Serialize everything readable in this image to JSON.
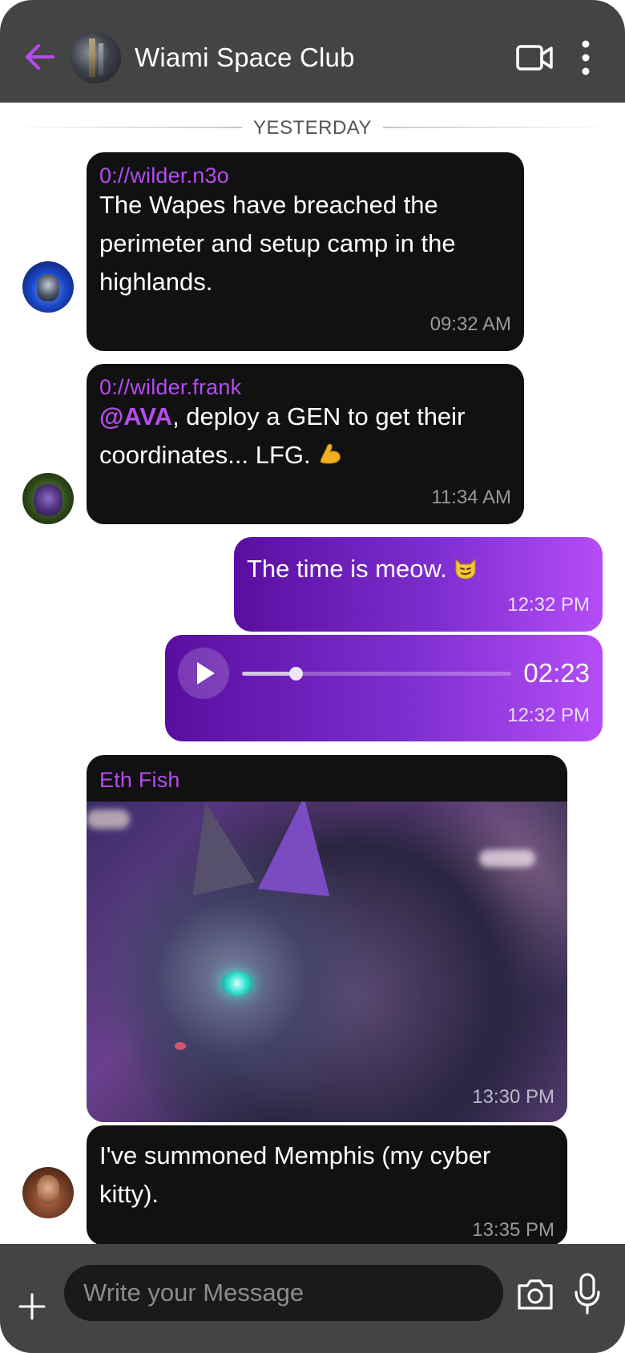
{
  "header": {
    "title": "Wiami Space Club",
    "back_icon": "arrow-left-icon",
    "video_icon": "video-call-icon",
    "more_icon": "more-vertical-icon"
  },
  "divider": {
    "label": "YESTERDAY"
  },
  "messages": [
    {
      "sender": "0://wilder.n3o",
      "lines": [
        "The Wapes have breached the",
        "perimeter and setup camp in the",
        "highlands."
      ],
      "time": "09:32 AM"
    },
    {
      "sender": "0://wilder.frank",
      "mention": "@AVA",
      "line1_rest": ", deploy a GEN to get their",
      "line2": "coordinates... LFG.",
      "emoji": "💪",
      "time": "11:34 AM"
    },
    {
      "text": "The time is meow.",
      "emoji": "😼",
      "time": "12:32 PM"
    },
    {
      "type": "audio",
      "duration": "02:23",
      "progress": 0.2,
      "time": "12:32 PM"
    },
    {
      "sender": "Eth Fish",
      "type": "image",
      "time": "13:30 PM"
    },
    {
      "lines": [
        "I've summoned Memphis (my cyber",
        "kitty)."
      ],
      "time": "13:35 PM"
    }
  ],
  "composer": {
    "placeholder": "Write your Message",
    "plus_icon": "plus-icon",
    "camera_icon": "camera-icon",
    "mic_icon": "microphone-icon"
  },
  "colors": {
    "header_bg": "#444444",
    "accent": "#b64cf0",
    "bubble_dark": "#111111",
    "bubble_purple_start": "#5a0ea0",
    "bubble_purple_end": "#b54df6"
  }
}
